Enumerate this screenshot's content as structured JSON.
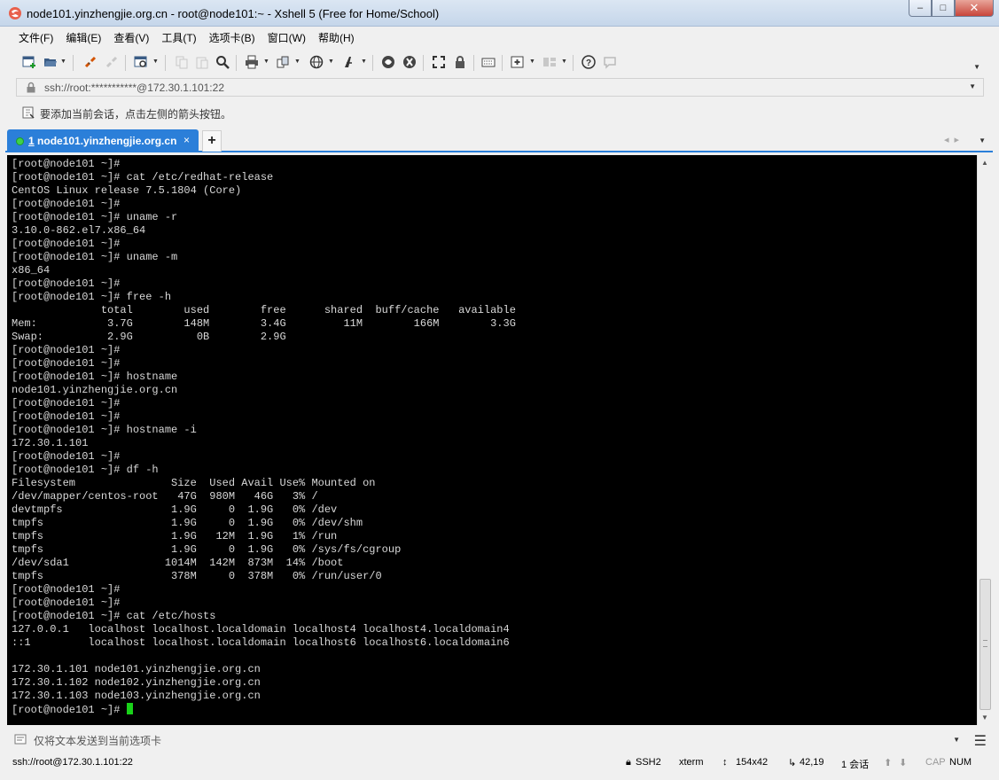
{
  "window": {
    "title": "node101.yinzhengjie.org.cn - root@node101:~ - Xshell 5 (Free for Home/School)",
    "minimize_glyph": "–",
    "maximize_glyph": "□",
    "close_glyph": "✕"
  },
  "menu": {
    "items": [
      "文件(F)",
      "编辑(E)",
      "查看(V)",
      "工具(T)",
      "选项卡(B)",
      "窗口(W)",
      "帮助(H)"
    ]
  },
  "toolbar": {
    "icons": [
      "new-session-icon",
      "open-folder-icon",
      "reconnect-icon",
      "disconnect-icon",
      "session-properties-icon",
      "copy-icon",
      "paste-icon",
      "find-icon",
      "print-icon",
      "transfer-icon",
      "globe-icon",
      "font-icon",
      "xftp-icon",
      "xmanager-icon",
      "fullscreen-icon",
      "lock-icon",
      "keyboard-icon",
      "new-tab-icon",
      "layout-icon",
      "help-icon",
      "chat-icon"
    ]
  },
  "address": {
    "value": "ssh://root:***********@172.30.1.101:22"
  },
  "hint": {
    "text": "要添加当前会话，点击左侧的箭头按钮。"
  },
  "tabs": {
    "active_index": "1",
    "active_label": "node101.yinzhengjie.org.cn",
    "close_glyph": "×",
    "add_glyph": "+"
  },
  "terminal": {
    "lines": [
      "[root@node101 ~]#",
      "[root@node101 ~]# cat /etc/redhat-release",
      "CentOS Linux release 7.5.1804 (Core)",
      "[root@node101 ~]#",
      "[root@node101 ~]# uname -r",
      "3.10.0-862.el7.x86_64",
      "[root@node101 ~]#",
      "[root@node101 ~]# uname -m",
      "x86_64",
      "[root@node101 ~]#",
      "[root@node101 ~]# free -h",
      "              total        used        free      shared  buff/cache   available",
      "Mem:           3.7G        148M        3.4G         11M        166M        3.3G",
      "Swap:          2.9G          0B        2.9G",
      "[root@node101 ~]#",
      "[root@node101 ~]#",
      "[root@node101 ~]# hostname",
      "node101.yinzhengjie.org.cn",
      "[root@node101 ~]#",
      "[root@node101 ~]#",
      "[root@node101 ~]# hostname -i",
      "172.30.1.101",
      "[root@node101 ~]#",
      "[root@node101 ~]# df -h",
      "Filesystem               Size  Used Avail Use% Mounted on",
      "/dev/mapper/centos-root   47G  980M   46G   3% /",
      "devtmpfs                 1.9G     0  1.9G   0% /dev",
      "tmpfs                    1.9G     0  1.9G   0% /dev/shm",
      "tmpfs                    1.9G   12M  1.9G   1% /run",
      "tmpfs                    1.9G     0  1.9G   0% /sys/fs/cgroup",
      "/dev/sda1               1014M  142M  873M  14% /boot",
      "tmpfs                    378M     0  378M   0% /run/user/0",
      "[root@node101 ~]#",
      "[root@node101 ~]#",
      "[root@node101 ~]# cat /etc/hosts",
      "127.0.0.1   localhost localhost.localdomain localhost4 localhost4.localdomain4",
      "::1         localhost localhost.localdomain localhost6 localhost6.localdomain6",
      "",
      "172.30.1.101 node101.yinzhengjie.org.cn",
      "172.30.1.102 node102.yinzhengjie.org.cn",
      "172.30.1.103 node103.yinzhengjie.org.cn"
    ],
    "prompt": "[root@node101 ~]# ",
    "cursor_color": "#19d219"
  },
  "compose": {
    "placeholder": "仅将文本发送到当前选项卡"
  },
  "status": {
    "connection": "ssh://root@172.30.1.101:22",
    "protocol": "SSH2",
    "terminal_type": "xterm",
    "size": "154x42",
    "cursor_pos": "42,19",
    "sessions": "1 会话",
    "cap": "CAP",
    "num": "NUM"
  },
  "colors": {
    "tab_accent": "#2b7fd9",
    "terminal_bg": "#000000",
    "terminal_fg": "#d8d8d8"
  }
}
